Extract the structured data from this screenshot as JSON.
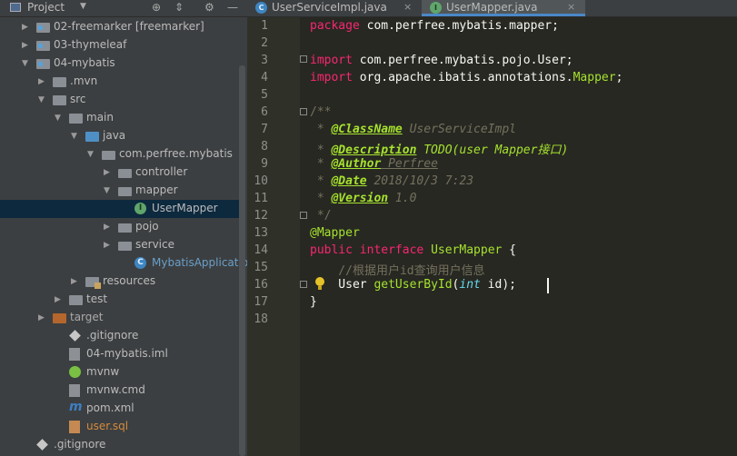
{
  "project_panel": {
    "title": "Project",
    "tree": [
      {
        "label": "02-freemarker [freemarker]",
        "depth": 1,
        "icon": "module-folder-icon",
        "expanded": false
      },
      {
        "label": "03-thymeleaf",
        "depth": 1,
        "icon": "module-folder-icon",
        "expanded": false
      },
      {
        "label": "04-mybatis",
        "depth": 1,
        "icon": "module-folder-icon",
        "expanded": true
      },
      {
        "label": ".mvn",
        "depth": 2,
        "icon": "folder-icon",
        "expanded": false
      },
      {
        "label": "src",
        "depth": 2,
        "icon": "folder-icon",
        "expanded": true
      },
      {
        "label": "main",
        "depth": 3,
        "icon": "folder-icon",
        "expanded": true
      },
      {
        "label": "java",
        "depth": 4,
        "icon": "source-folder-icon",
        "expanded": true
      },
      {
        "label": "com.perfree.mybatis",
        "depth": 5,
        "icon": "package-icon",
        "expanded": true
      },
      {
        "label": "controller",
        "depth": 6,
        "icon": "package-icon",
        "expanded": false
      },
      {
        "label": "mapper",
        "depth": 6,
        "icon": "package-icon",
        "expanded": true
      },
      {
        "label": "UserMapper",
        "depth": 7,
        "icon": "interface-icon",
        "selected": true
      },
      {
        "label": "pojo",
        "depth": 6,
        "icon": "package-icon",
        "expanded": false
      },
      {
        "label": "service",
        "depth": 6,
        "icon": "package-icon",
        "expanded": false
      },
      {
        "label": "MybatisApplication",
        "depth": 7,
        "icon": "spring-class-icon"
      },
      {
        "label": "resources",
        "depth": 4,
        "icon": "resources-folder-icon",
        "expanded": false
      },
      {
        "label": "test",
        "depth": 3,
        "icon": "folder-icon",
        "expanded": false
      },
      {
        "label": "target",
        "depth": 2,
        "icon": "excluded-folder-icon",
        "expanded": false
      },
      {
        "label": ".gitignore",
        "depth": 3,
        "icon": "git-icon"
      },
      {
        "label": "04-mybatis.iml",
        "depth": 3,
        "icon": "iml-file-icon"
      },
      {
        "label": "mvnw",
        "depth": 3,
        "icon": "mvnw-icon"
      },
      {
        "label": "mvnw.cmd",
        "depth": 3,
        "icon": "text-file-icon"
      },
      {
        "label": "pom.xml",
        "depth": 3,
        "icon": "maven-icon"
      },
      {
        "label": "user.sql",
        "depth": 3,
        "icon": "sql-file-icon"
      },
      {
        "label": ".gitignore",
        "depth": 1,
        "icon": "git-icon"
      }
    ]
  },
  "tabs": [
    {
      "label": "UserServiceImpl.java",
      "icon": "class-icon",
      "active": false
    },
    {
      "label": "UserMapper.java",
      "icon": "interface-icon",
      "active": true
    }
  ],
  "editor": {
    "line_numbers": [
      "1",
      "2",
      "3",
      "4",
      "5",
      "6",
      "7",
      "8",
      "9",
      "10",
      "11",
      "12",
      "13",
      "14",
      "15",
      "16",
      "17",
      "18"
    ],
    "code": {
      "l1_kw": "package",
      "l1_rest": " com.perfree.mybatis.mapper;",
      "l3_kw": "import",
      "l3_rest": " com.perfree.mybatis.pojo.User;",
      "l4_kw": "import",
      "l4_pre": " org.apache.ibatis.annotations.",
      "l4_cls": "Mapper",
      "l4_end": ";",
      "l6": "/**",
      "l7_star": " * ",
      "l7_tag": "@ClassName",
      "l7_val": " UserServiceImpl",
      "l8_star": " * ",
      "l8_tag": "@Description",
      "l8_val": " TODO(user Mapper接口)",
      "l9_star": " * ",
      "l9_tag": "@Author",
      "l9_val": " Perfree",
      "l10_star": " * ",
      "l10_tag": "@Date",
      "l10_val": " 2018/10/3 7:23",
      "l11_star": " * ",
      "l11_tag": "@Version",
      "l11_val": " 1.0",
      "l12": " */",
      "l13": "@Mapper",
      "l14_kw1": "public",
      "l14_kw2": " interface",
      "l14_name": " UserMapper",
      "l14_end": " {",
      "l15": "    //根据用户id查询用户信息",
      "l16_ret": "    User ",
      "l16_fn": "getUserById",
      "l16_p1": "(",
      "l16_type": "int",
      "l16_p2": " id);",
      "l17": "}"
    }
  },
  "colors": {
    "editor_bg": "#272822",
    "keyword": "#f92672",
    "annotation": "#a6e22e",
    "comment": "#75715e",
    "type": "#66d9ef",
    "tab_active_underline": "#4a88c7",
    "selection": "#0d293e"
  }
}
